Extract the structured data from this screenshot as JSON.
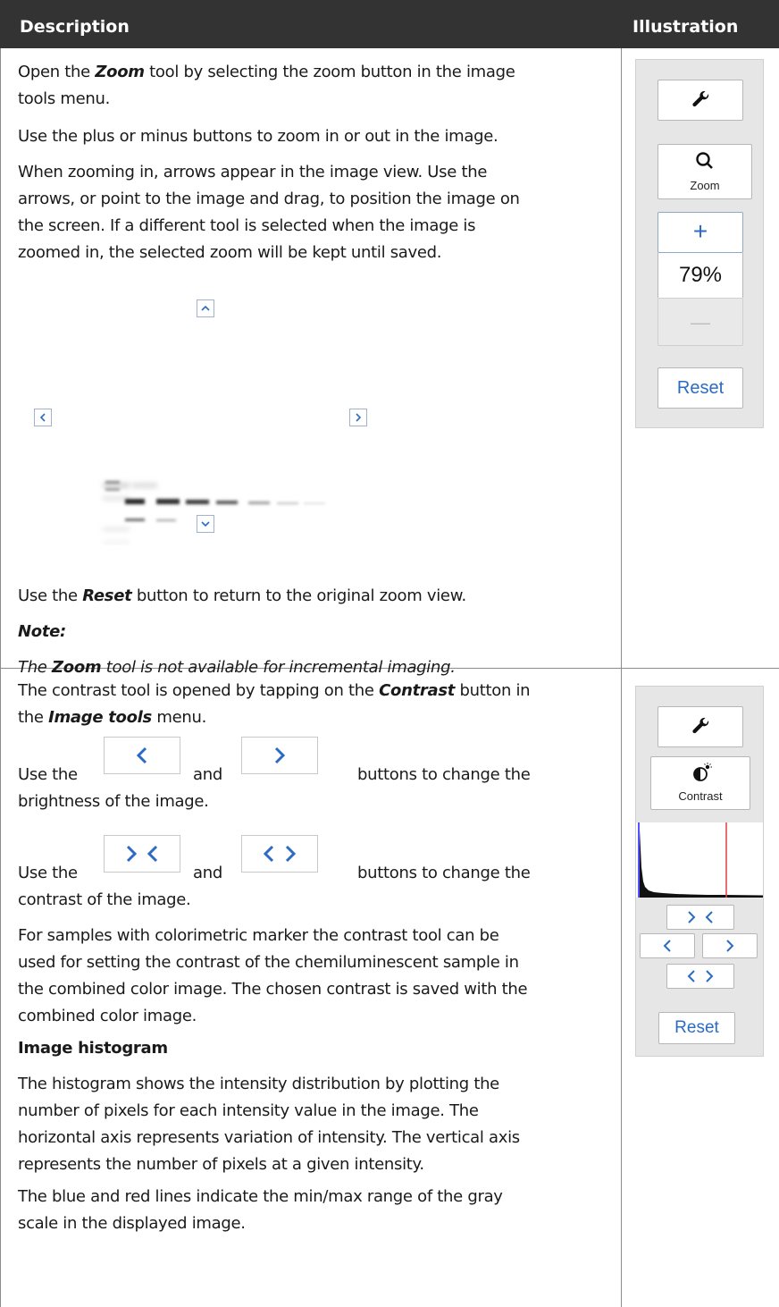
{
  "header": {
    "description": "Description",
    "illustration": "Illustration"
  },
  "row1": {
    "p1_pre": "Open the ",
    "p1_bold": "Zoom",
    "p1_post_a": " tool by selecting the zoom button in the image",
    "p1_post_b": "tools menu.",
    "p2": "Use the plus or minus buttons to zoom in or out in the image.",
    "p3_lines": [
      "When zooming in, arrows appear in the image view. Use the",
      "arrows, or point to the image and drag, to position the image on",
      "the screen. If a different tool is selected when the image is",
      "zoomed in, the selected zoom will be kept until saved."
    ],
    "p4_pre": "Use the ",
    "p4_bold": "Reset",
    "p4_post": " button to return to the original zoom view.",
    "note_label": "Note:",
    "note_pre": "The ",
    "note_bold": "Zoom",
    "note_post": " tool is not available for incremental imaging.",
    "panel": {
      "zoom_label": "Zoom",
      "zoom_value": "79%",
      "reset_label": "Reset",
      "plus": "+",
      "minus": "—"
    }
  },
  "row2": {
    "p1_pre": "The contrast tool is opened by tapping on the ",
    "p1_bold": "Contrast",
    "p1_post": " button in",
    "p1_line2_pre": "the ",
    "p1_line2_bold": "Image tools",
    "p1_line2_post": " menu.",
    "brightness_a": "Use the",
    "brightness_b": "and",
    "brightness_c": "buttons to change the",
    "brightness_d": "brightness of the image.",
    "contrast_a": "Use the",
    "contrast_b": "and",
    "contrast_c": "buttons to change the",
    "contrast_d": "contrast of the image.",
    "p4_lines": [
      "For samples with colorimetric marker the contrast tool can be",
      "used for setting the contrast of the chemiluminescent sample in",
      "the combined color image. The chosen contrast is saved with the",
      "combined color image."
    ],
    "histogram_heading": "Image histogram",
    "p5_lines": [
      "The histogram shows the intensity distribution by plotting the",
      "number of pixels for each intensity value in the image. The",
      "horizontal axis represents variation of intensity. The vertical axis",
      "represents the number of pixels at a given intensity."
    ],
    "p6_lines": [
      "The blue and red lines indicate the min/max range of the gray",
      "scale in the displayed image."
    ],
    "panel": {
      "contrast_label": "Contrast",
      "reset_label": "Reset"
    }
  },
  "colors": {
    "header_bg": "#333333",
    "accent_blue": "#2b6bc4",
    "histogram_min": "#1a1aff",
    "histogram_max": "#e04040"
  }
}
